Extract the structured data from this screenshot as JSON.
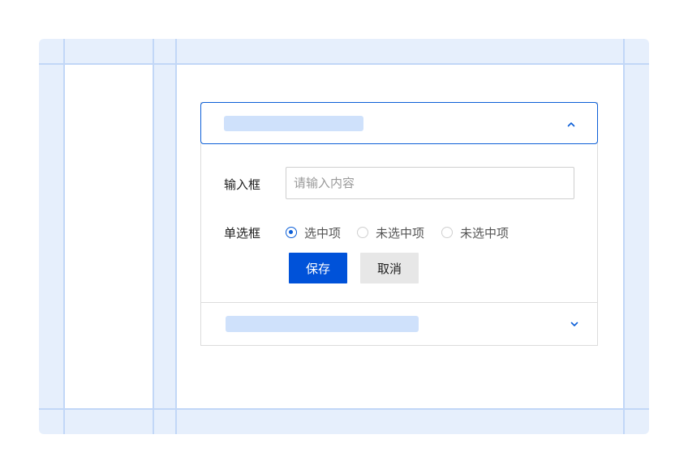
{
  "collapse": {
    "panel1": {
      "expanded": true,
      "chevron_icon": "chevron-up-icon",
      "form": {
        "input_label": "输入框",
        "input_placeholder": "请输入内容",
        "input_value": "",
        "radio_label": "单选框",
        "radio_options": [
          {
            "label": "选中项",
            "checked": true
          },
          {
            "label": "未选中项",
            "checked": false
          },
          {
            "label": "未选中项",
            "checked": false
          }
        ],
        "save_label": "保存",
        "cancel_label": "取消"
      }
    },
    "panel2": {
      "expanded": false,
      "chevron_icon": "chevron-down-icon"
    }
  },
  "colors": {
    "accent": "#0052d9",
    "header_border": "#0b5ed7",
    "skeleton": "#cfe1fb",
    "grid_bg": "#e6effc",
    "grid_line": "#c2d7f7",
    "secondary_button": "#e7e7e7"
  }
}
